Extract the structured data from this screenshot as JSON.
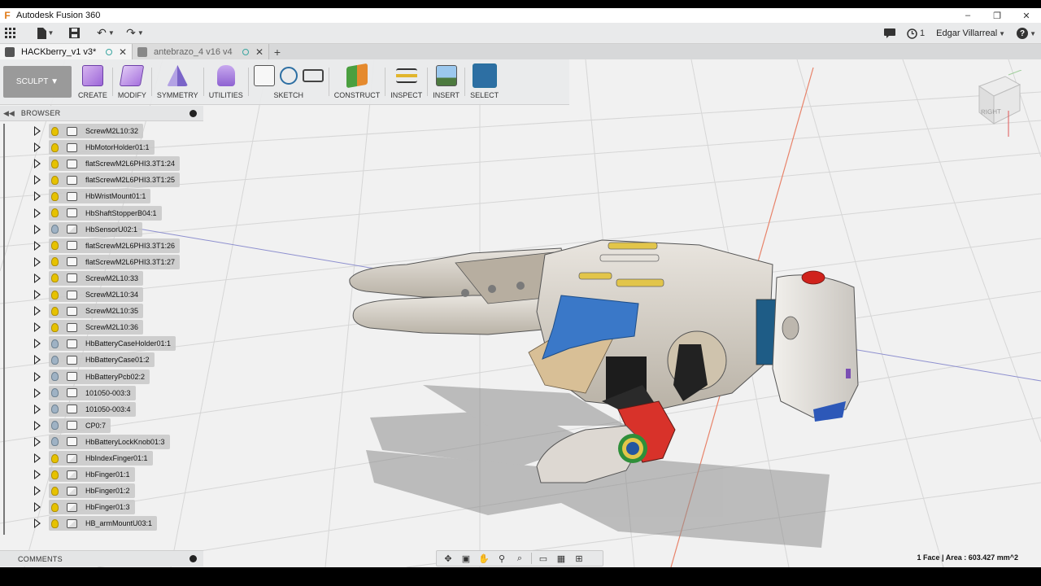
{
  "window": {
    "title": "Autodesk Fusion 360",
    "buttons": [
      "–",
      "❐",
      "✕"
    ]
  },
  "appbar": {
    "user": "Edgar Villarreal",
    "job_count": "1",
    "help": "?"
  },
  "tabs": [
    {
      "label": "HACKberry_v1 v3*",
      "active": true
    },
    {
      "label": "antebrazo_4 v16 v4",
      "active": false
    }
  ],
  "toolbar": {
    "workspace": "SCULPT",
    "groups": [
      {
        "label": "CREATE"
      },
      {
        "label": "MODIFY"
      },
      {
        "label": "SYMMETRY"
      },
      {
        "label": "UTILITIES"
      },
      {
        "label": "SKETCH"
      },
      {
        "label": "CONSTRUCT"
      },
      {
        "label": "INSPECT"
      },
      {
        "label": "INSERT"
      },
      {
        "label": "SELECT"
      }
    ]
  },
  "browser": {
    "title": "BROWSER",
    "items": [
      {
        "name": "ScrewM2L10:32",
        "visible": true,
        "link": false
      },
      {
        "name": "HbMotorHolder01:1",
        "visible": true,
        "link": false
      },
      {
        "name": "flatScrewM2L6PHI3.3T1:24",
        "visible": true,
        "link": false
      },
      {
        "name": "flatScrewM2L6PHI3.3T1:25",
        "visible": true,
        "link": false
      },
      {
        "name": "HbWristMount01:1",
        "visible": true,
        "link": false
      },
      {
        "name": "HbShaftStopperB04:1",
        "visible": true,
        "link": false
      },
      {
        "name": "HbSensorU02:1",
        "visible": false,
        "link": true
      },
      {
        "name": "flatScrewM2L6PHI3.3T1:26",
        "visible": true,
        "link": false
      },
      {
        "name": "flatScrewM2L6PHI3.3T1:27",
        "visible": true,
        "link": false
      },
      {
        "name": "ScrewM2L10:33",
        "visible": true,
        "link": false
      },
      {
        "name": "ScrewM2L10:34",
        "visible": true,
        "link": false
      },
      {
        "name": "ScrewM2L10:35",
        "visible": true,
        "link": false
      },
      {
        "name": "ScrewM2L10:36",
        "visible": true,
        "link": false
      },
      {
        "name": "HbBatteryCaseHolder01:1",
        "visible": false,
        "link": false
      },
      {
        "name": "HbBatteryCase01:2",
        "visible": false,
        "link": false
      },
      {
        "name": "HbBatteryPcb02:2",
        "visible": false,
        "link": false
      },
      {
        "name": "101050-003:3",
        "visible": false,
        "link": false
      },
      {
        "name": "101050-003:4",
        "visible": false,
        "link": false
      },
      {
        "name": "CP0:7",
        "visible": false,
        "link": false
      },
      {
        "name": "HbBatteryLockKnob01:3",
        "visible": false,
        "link": false
      },
      {
        "name": "HbIndexFinger01:1",
        "visible": true,
        "link": true
      },
      {
        "name": "HbFinger01:1",
        "visible": true,
        "link": true
      },
      {
        "name": "HbFinger01:2",
        "visible": true,
        "link": true
      },
      {
        "name": "HbFinger01:3",
        "visible": true,
        "link": true
      },
      {
        "name": "HB_armMountU03:1",
        "visible": true,
        "link": true
      }
    ]
  },
  "viewcube": {
    "face": "RIGHT"
  },
  "comments": {
    "title": "COMMENTS"
  },
  "status": {
    "selection": "1 Face | Area : 603.427 mm^2"
  },
  "colors": {
    "accent": "#2d6fa3",
    "grid": "#d2d2d2",
    "model_body": "#d8d2c9",
    "selected_face": "#3a78c8"
  }
}
